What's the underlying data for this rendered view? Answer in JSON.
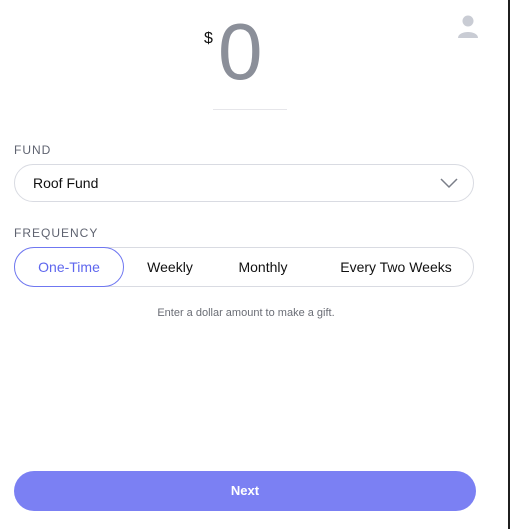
{
  "amount": {
    "currency": "$",
    "value": "0"
  },
  "fund": {
    "label": "FUND",
    "selected": "Roof Fund"
  },
  "frequency": {
    "label": "FREQUENCY",
    "options": [
      "One-Time",
      "Weekly",
      "Monthly",
      "Every Two Weeks"
    ],
    "selected": "One-Time"
  },
  "hint": "Enter a dollar amount to make a gift.",
  "next_label": "Next",
  "colors": {
    "accent": "#7b80f3",
    "active_text": "#5e66ee",
    "amount_text": "#8b8f99"
  },
  "icons": {
    "avatar": "user-icon",
    "dropdown": "chevron-down-icon"
  }
}
